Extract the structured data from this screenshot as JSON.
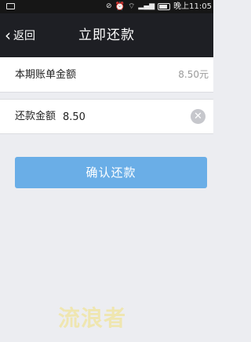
{
  "status_bar": {
    "icons": [
      "notification-icon",
      "no-signal-icon",
      "alarm-icon",
      "wifi-icon",
      "signal-icon",
      "battery-icon"
    ],
    "time": "晚上11:05"
  },
  "nav": {
    "back_label": "返回",
    "title": "立即还款"
  },
  "bill": {
    "label": "本期账单金额",
    "amount": "8.50元"
  },
  "payment": {
    "label": "还款金额",
    "value": "8.50"
  },
  "confirm_button": {
    "label": "确认还款",
    "color": "#6aaee7"
  },
  "watermark": {
    "text": "流浪者"
  },
  "colors": {
    "nav_background": "#1e1f24",
    "page_background": "#ecedf1"
  }
}
